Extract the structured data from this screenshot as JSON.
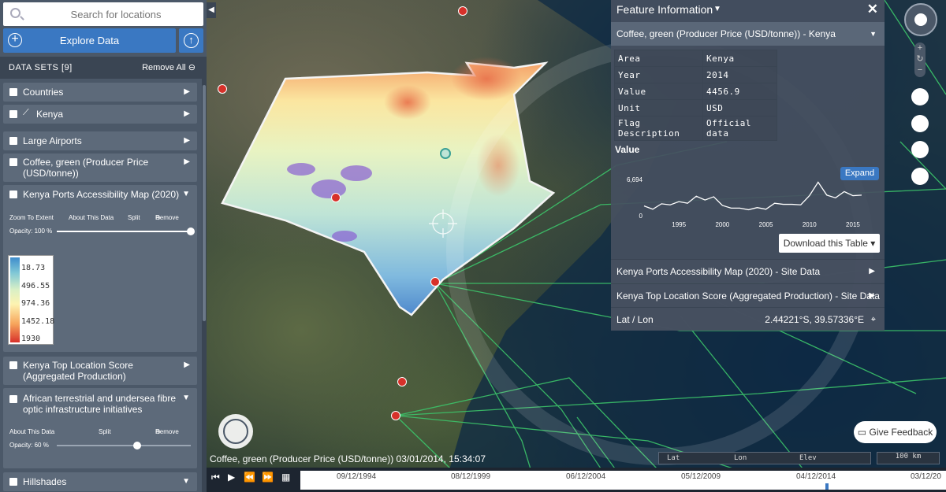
{
  "search": {
    "placeholder": "Search for locations"
  },
  "explore": {
    "label": "Explore Data"
  },
  "datasets": {
    "title": "DATA SETS  [9]",
    "remove_all": "Remove All"
  },
  "layers": [
    {
      "label": "Countries"
    },
    {
      "label": "Kenya"
    },
    {
      "label": "Large Airports"
    },
    {
      "label": "Coffee, green (Producer Price (USD/tonne))"
    },
    {
      "label": "Kenya Ports Accessibility Map (2020)"
    },
    {
      "label": "Kenya Top Location Score (Aggregated Production)"
    },
    {
      "label": "African terrestrial and undersea fibre optic infrastructure initiatives"
    },
    {
      "label": "Hillshades"
    }
  ],
  "ports_layer": {
    "zoom": "Zoom To Extent",
    "about": "About This Data",
    "split": "Split",
    "remove": "Remove",
    "opacity_label": "Opacity: 100 %",
    "opacity": 1.0
  },
  "fibre_layer": {
    "about": "About This Data",
    "split": "Split",
    "remove": "Remove",
    "opacity_label": "Opacity: 60 %",
    "opacity": 0.6
  },
  "legend": {
    "values": [
      "18.73",
      "496.55",
      "974.36",
      "1452.18",
      "1930"
    ]
  },
  "feature": {
    "title": "Feature Information",
    "subtitle": "Coffee, green (Producer Price (USD/tonne)) - Kenya",
    "table": [
      {
        "k": "Area",
        "v": "Kenya"
      },
      {
        "k": "Year",
        "v": "2014"
      },
      {
        "k": "Value",
        "v": "4456.9"
      },
      {
        "k": "Unit",
        "v": "USD"
      },
      {
        "k": "Flag Description",
        "v": "Official data"
      }
    ],
    "chart_label": "Value",
    "expand": "Expand",
    "download": "Download this Table",
    "row1": "Kenya Ports Accessibility Map (2020) - Site Data",
    "row2": "Kenya Top Location Score (Aggregated Production) - Site Data",
    "latlon_label": "Lat / Lon",
    "latlon_value": "2.44221°S, 39.57336°E"
  },
  "chart_data": {
    "type": "line",
    "x": [
      1991,
      1992,
      1993,
      1994,
      1995,
      1996,
      1997,
      1998,
      1999,
      2000,
      2001,
      2002,
      2003,
      2004,
      2005,
      2006,
      2007,
      2008,
      2009,
      2010,
      2011,
      2012,
      2013,
      2014,
      2015,
      2016
    ],
    "series": [
      {
        "values": [
          1800,
          1200,
          2200,
          2000,
          2600,
          2300,
          3600,
          2900,
          3500,
          1900,
          1400,
          1400,
          1100,
          1500,
          1200,
          2300,
          2100,
          2100,
          2000,
          3700,
          6200,
          3800,
          3300,
          4457,
          3700,
          3800
        ]
      }
    ],
    "ytick_labels": [
      "0",
      "6,694"
    ],
    "xtick_labels": [
      "1995",
      "2000",
      "2005",
      "2010",
      "2015"
    ],
    "ylim": [
      0,
      6694
    ]
  },
  "status": {
    "label": "Coffee, green (Producer Price (USD/tonne)) 03/01/2014, 15:34:07"
  },
  "coords": {
    "lat": "Lat",
    "lon": "Lon",
    "elev": "Elev"
  },
  "scale": {
    "label": "100 km"
  },
  "timeline": {
    "dates": [
      "09/12/1994",
      "08/12/1999",
      "06/12/2004",
      "05/12/2009",
      "04/12/2014",
      "03/12/20"
    ]
  },
  "feedback": {
    "label": "Give Feedback"
  },
  "colors": {
    "accent": "#3a78c2",
    "sidebar": "#4b5868",
    "marker": "#d7312a",
    "fibre": "#3cc46a"
  }
}
